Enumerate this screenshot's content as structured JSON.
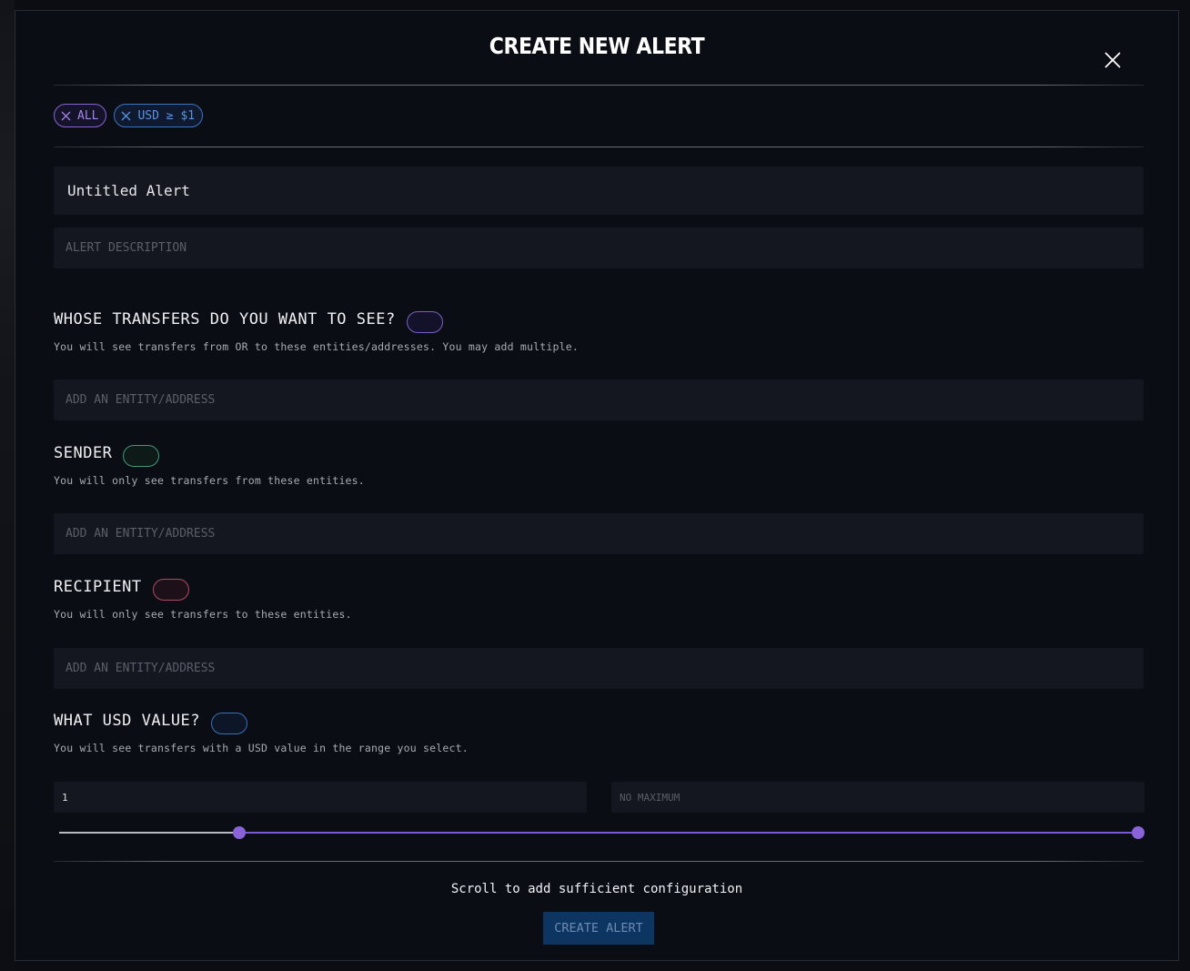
{
  "modal": {
    "title": "CREATE NEW ALERT"
  },
  "chips": [
    {
      "label": "ALL",
      "color": "#8a63d2"
    },
    {
      "label": "USD ≥ $1",
      "color": "#3c74c4"
    }
  ],
  "alert": {
    "name_value": "Untitled Alert",
    "description_placeholder": "ALERT DESCRIPTION"
  },
  "sections": {
    "whose": {
      "title": "WHOSE TRANSFERS DO YOU WANT TO SEE?",
      "description": "You will see transfers from OR to these entities/addresses. You may add multiple.",
      "placeholder": "ADD AN ENTITY/ADDRESS",
      "toggle_color": "#7a5fc4"
    },
    "sender": {
      "title": "SENDER",
      "description": "You will only see transfers from these entities.",
      "placeholder": "ADD AN ENTITY/ADDRESS",
      "toggle_color": "#3f9a76"
    },
    "recipient": {
      "title": "RECIPIENT",
      "description": "You will only see transfers to these entities.",
      "placeholder": "ADD AN ENTITY/ADDRESS",
      "toggle_color": "#b04a64"
    },
    "usd": {
      "title": "WHAT USD VALUE?",
      "description": "You will see transfers with a USD value in the range you select.",
      "min_value": "1",
      "max_placeholder": "NO MAXIMUM",
      "toggle_color": "#3c6fb8",
      "slider_low_fraction": 0.167,
      "slider_high_fraction": 1.0
    }
  },
  "footer": {
    "note": "Scroll to add sufficient configuration",
    "create_button_label": "CREATE ALERT"
  },
  "colors": {
    "accent_purple": "#8a63d8",
    "button_bg": "#0d3561",
    "background": "#0b0d15"
  }
}
